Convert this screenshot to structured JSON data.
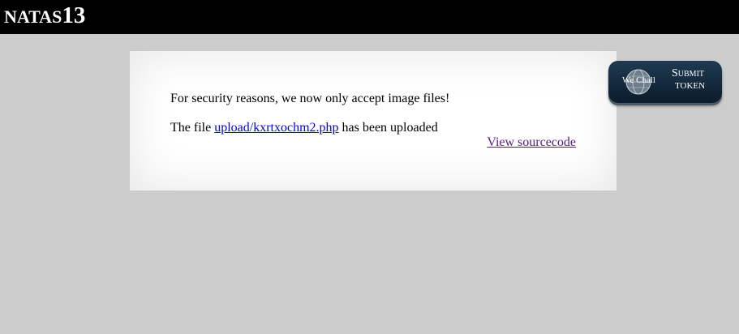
{
  "header": {
    "title_prefix": "NATAS",
    "title_number": "13"
  },
  "content": {
    "notice": "For security reasons, we now only accept image files!",
    "upload_prefix": "The file ",
    "upload_link": "upload/kxrtxochm2.php",
    "upload_suffix": " has been uploaded",
    "view_source": "View sourcecode"
  },
  "wechall": {
    "logo_text": "We Chall",
    "submit_label": "Submit",
    "token_label": "TOKEN"
  },
  "colors": {
    "header_bg": "#000000",
    "page_bg": "#cccccc",
    "link": "#0000ee",
    "visited_link": "#551a8b",
    "button_bg": "#142c42"
  }
}
